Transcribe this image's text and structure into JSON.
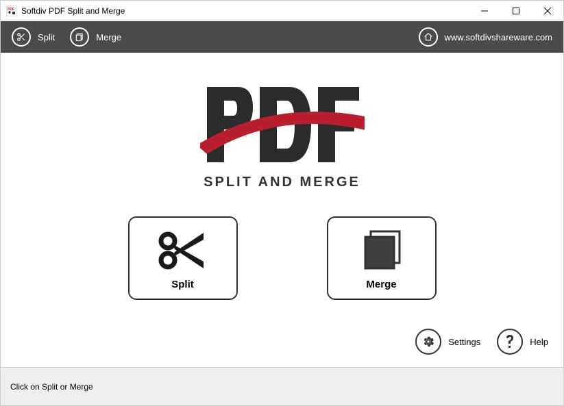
{
  "window": {
    "title": "Softdiv PDF Split and Merge"
  },
  "toolbar": {
    "split_label": "Split",
    "merge_label": "Merge",
    "home_url": "www.softdivshareware.com"
  },
  "logo": {
    "subtitle": "SPLIT AND MERGE"
  },
  "cards": {
    "split_label": "Split",
    "merge_label": "Merge"
  },
  "actions": {
    "settings_label": "Settings",
    "help_label": "Help"
  },
  "statusbar": {
    "message": "Click on Split or Merge"
  }
}
